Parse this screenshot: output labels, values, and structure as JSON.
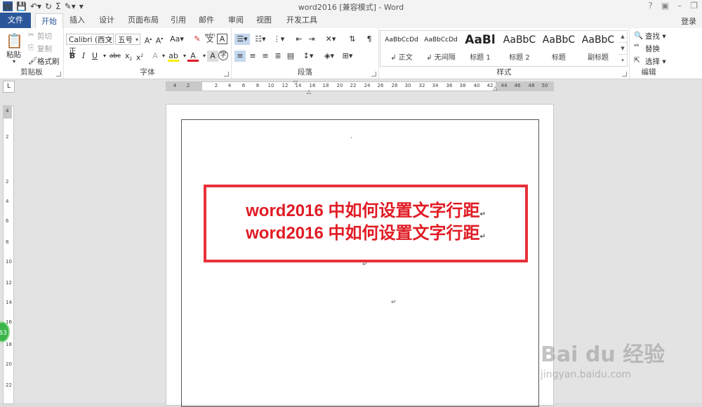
{
  "window": {
    "title": "word2016 [兼容模式] - Word",
    "login": "登录"
  },
  "tabs": [
    "文件",
    "开始",
    "插入",
    "设计",
    "页面布局",
    "引用",
    "邮件",
    "审阅",
    "视图",
    "开发工具"
  ],
  "clipboard": {
    "paste": "粘贴",
    "cut": "剪切",
    "copy": "复制",
    "format_painter": "格式刷",
    "label": "剪贴板"
  },
  "font": {
    "family": "Calibri (西文正",
    "size": "五号",
    "label": "字体",
    "wen": "wén",
    "wen_char": "文",
    "boxed_a": "A"
  },
  "paragraph": {
    "label": "段落"
  },
  "styles": {
    "label": "样式",
    "items": [
      {
        "sample": "AaBbCcDd",
        "name": "正文"
      },
      {
        "sample": "AaBbCcDd",
        "name": "无间隔"
      },
      {
        "sample": "AaBl",
        "name": "标题 1"
      },
      {
        "sample": "AaBbC",
        "name": "标题 2"
      },
      {
        "sample": "AaBbC",
        "name": "标题"
      },
      {
        "sample": "AaBbC",
        "name": "副标题"
      }
    ]
  },
  "editing": {
    "find": "查找",
    "replace": "替换",
    "select": "选择",
    "label": "编辑"
  },
  "ruler": {
    "corner": "L",
    "h_left": [
      "4",
      "2"
    ],
    "h_main": [
      "2",
      "4",
      "6",
      "8",
      "10",
      "12",
      "14",
      "16",
      "18",
      "20",
      "22",
      "24",
      "26",
      "28",
      "30",
      "32",
      "34",
      "36",
      "38",
      "40",
      "42"
    ],
    "h_right": [
      "44",
      "46",
      "48",
      "50"
    ],
    "v_top": [
      "4",
      "2"
    ],
    "v_main": [
      "2",
      "4",
      "6",
      "8",
      "10",
      "12",
      "14",
      "16",
      "18",
      "20",
      "22"
    ]
  },
  "document": {
    "line1": "word2016 中如何设置文字行距",
    "line2": "word2016 中如何设置文字行距",
    "mark": "↵"
  },
  "badge": "63",
  "watermark": {
    "brand": "Bai du 经验",
    "url": "jingyan.baidu.com"
  }
}
